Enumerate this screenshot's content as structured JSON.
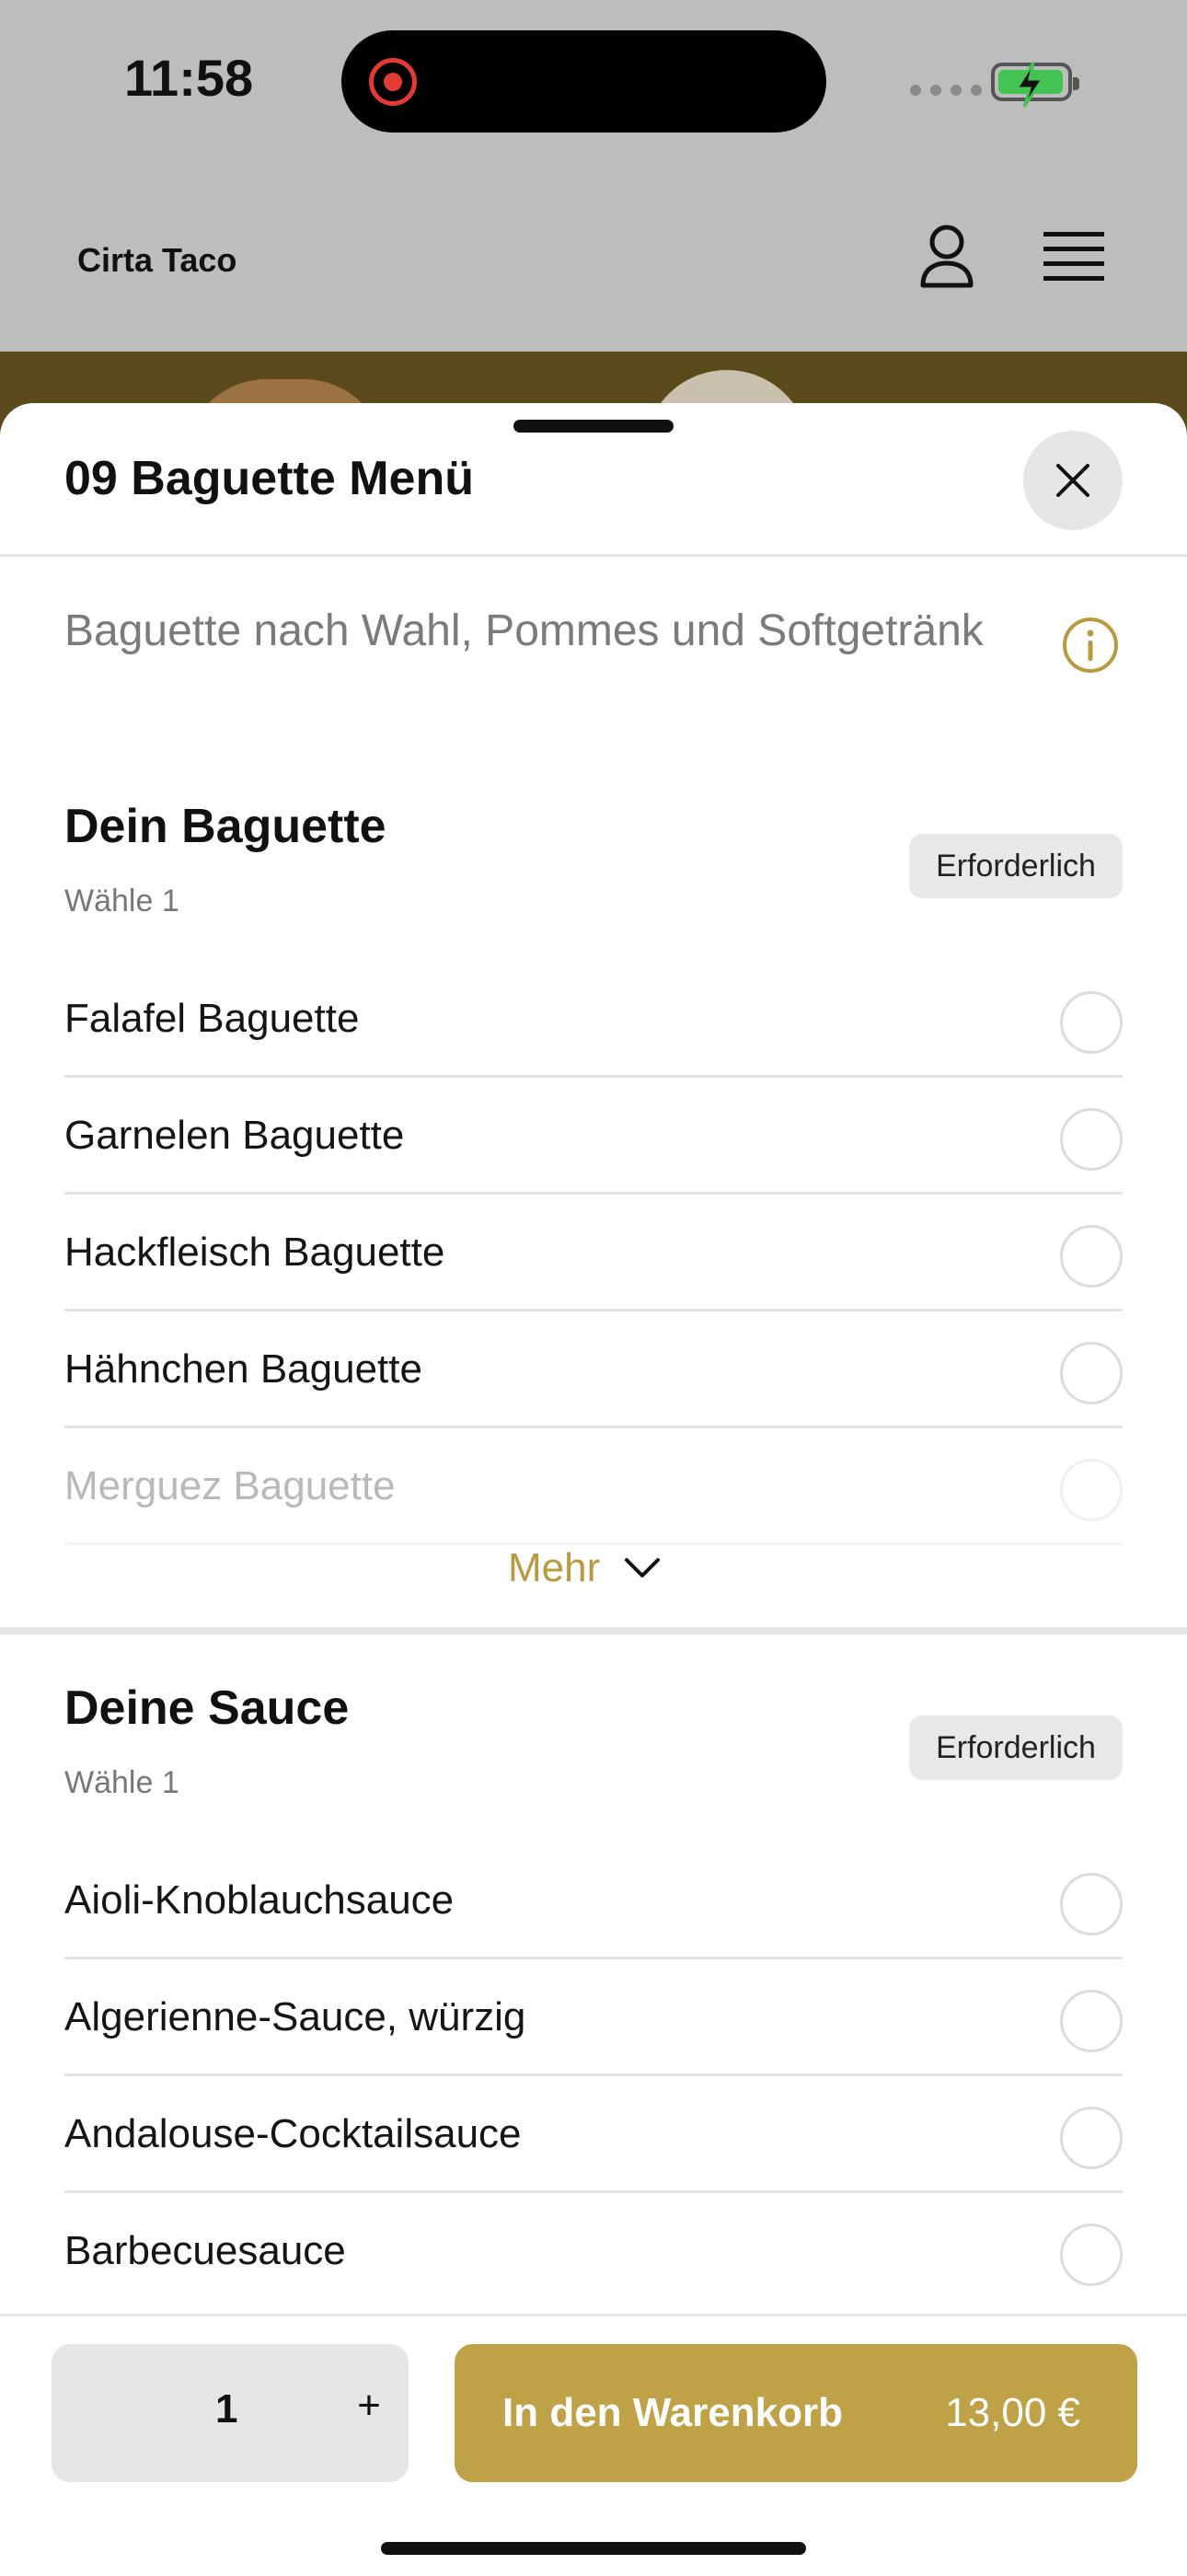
{
  "status_bar": {
    "time": "11:58"
  },
  "app": {
    "brand": "Cirta Taco"
  },
  "sheet": {
    "title": "09 Baguette Menü",
    "description": "Baguette nach Wahl, Pommes und Softgetränk"
  },
  "sections": [
    {
      "title": "Dein Baguette",
      "subtitle": "Wähle 1",
      "badge": "Erforderlich",
      "options": [
        {
          "label": "Falafel Baguette"
        },
        {
          "label": "Garnelen Baguette"
        },
        {
          "label": "Hackfleisch Baguette"
        },
        {
          "label": "Hähnchen Baguette"
        },
        {
          "label": "Merguez Baguette"
        }
      ],
      "more_label": "Mehr"
    },
    {
      "title": "Deine Sauce",
      "subtitle": "Wähle 1",
      "badge": "Erforderlich",
      "options": [
        {
          "label": "Aioli-Knoblauchsauce"
        },
        {
          "label": "Algerienne-Sauce, würzig"
        },
        {
          "label": "Andalouse-Cocktailsauce"
        },
        {
          "label": "Barbecuesauce"
        }
      ]
    }
  ],
  "bottom_bar": {
    "quantity": "1",
    "plus_label": "+",
    "cart_label": "In den Warenkorb",
    "price": "13,00 €"
  },
  "colors": {
    "accent": "#bfa247",
    "accent_text": "#b89b3e",
    "overlay": "#bdbdbd"
  }
}
